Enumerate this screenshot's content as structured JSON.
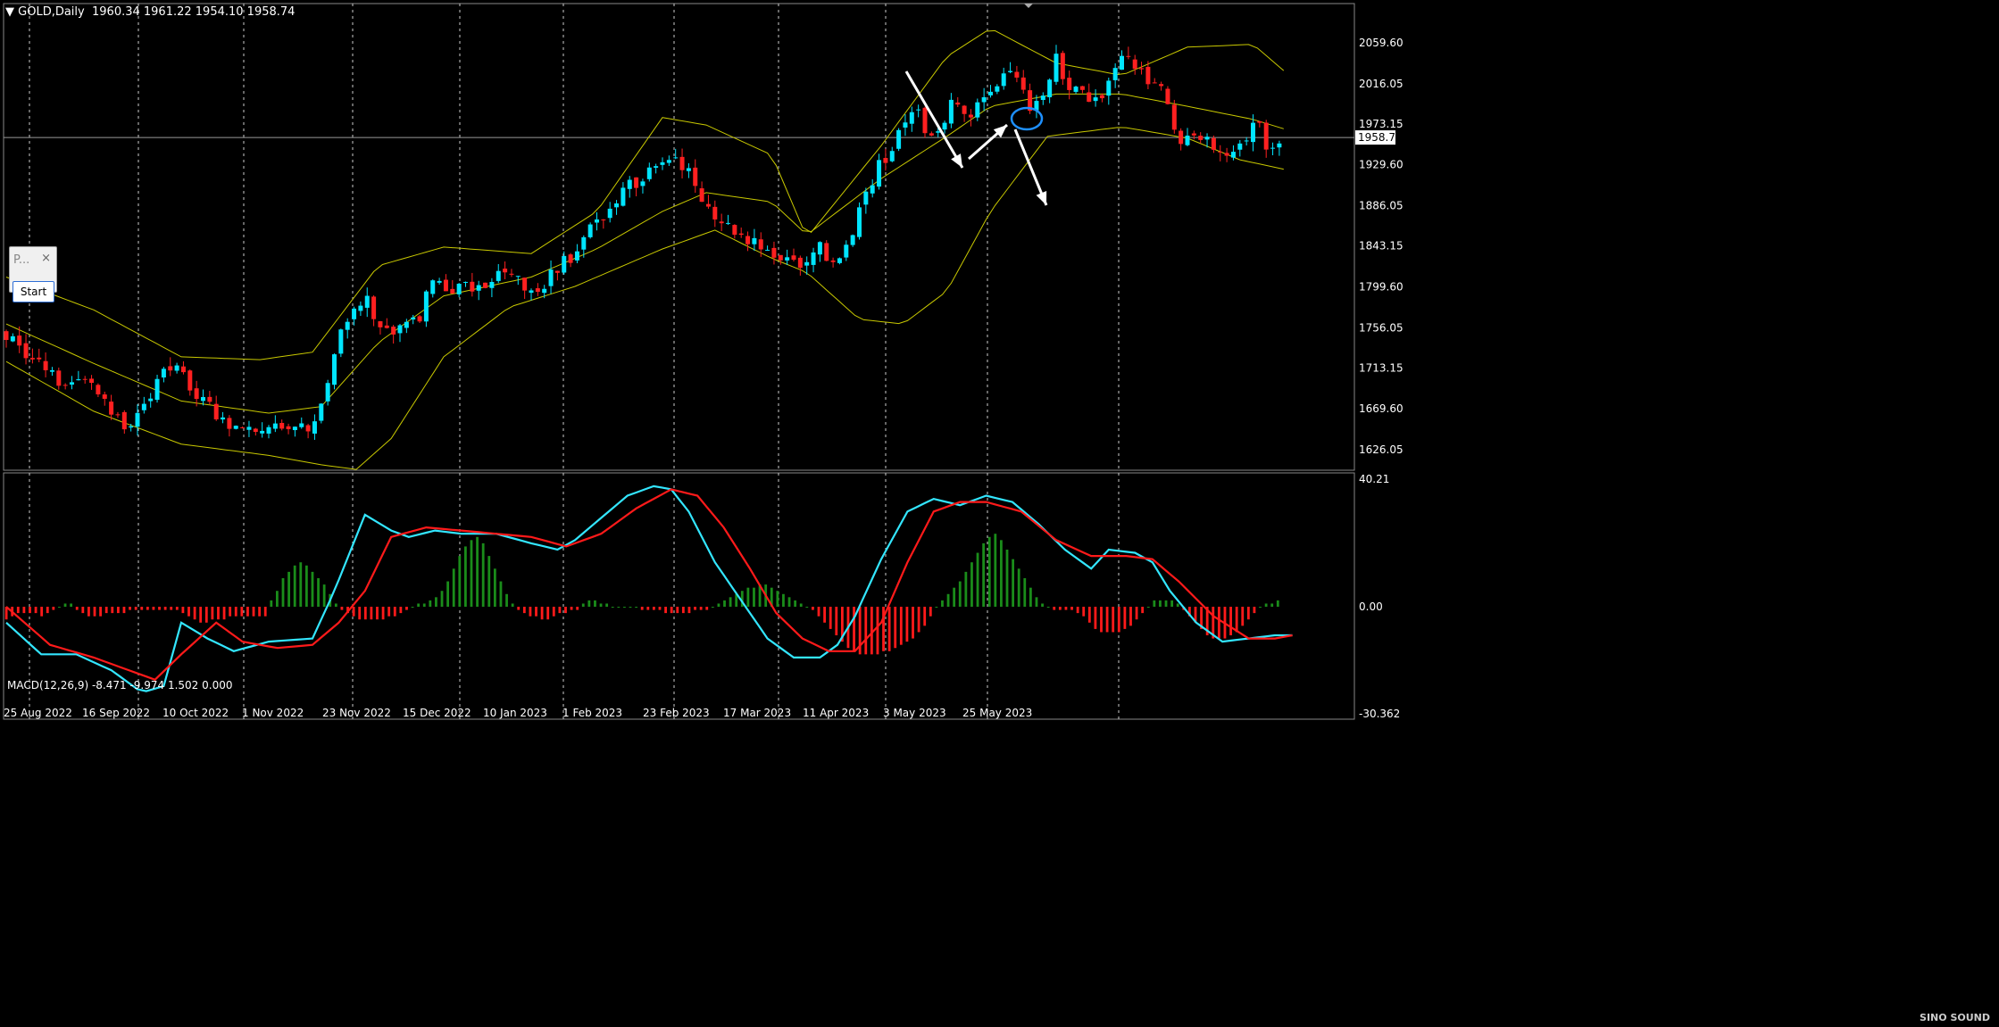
{
  "header": {
    "symbol_label": "GOLD,Daily",
    "ohlc": "1960.34 1961.22 1954.10 1958.74"
  },
  "indicator_title": "MACD(12,26,9) -8.471 -9.974 1.502 0.000",
  "panel": {
    "label": "P...",
    "close": "×",
    "start_label": "Start"
  },
  "logo_text": "SINO SOUND",
  "colors": {
    "background": "#000000",
    "bull_candle": "#00e5ff",
    "bear_candle": "#ff2020",
    "bollinger": "#c8c800",
    "macd_line": "#33e6ff",
    "signal_line": "#ff1a1a",
    "hist_pos": "#1a8c1a",
    "hist_neg": "#ff1a1a",
    "annotation": "#ffffff",
    "circle": "#1e90ff",
    "grid": "#cccccc"
  },
  "chart_data": [
    {
      "type": "candlestick",
      "title": "GOLD,Daily",
      "price_axis_ticks": [
        "2059.60",
        "2016.05",
        "1973.15",
        "1929.60",
        "1886.05",
        "1843.15",
        "1799.60",
        "1756.05",
        "1713.15",
        "1669.60",
        "1626.05"
      ],
      "current_price_label": "1958.74",
      "x_tick_labels": [
        "25 Aug 2022",
        "16 Sep 2022",
        "10 Oct 2022",
        "1 Nov 2022",
        "23 Nov 2022",
        "15 Dec 2022",
        "10 Jan 2023",
        "1 Feb 2023",
        "23 Feb 2023",
        "17 Mar 2023",
        "11 Apr 2023",
        "3 May 2023",
        "25 May 2023"
      ],
      "ylim": [
        1610,
        2090
      ],
      "grid": "vertical dashed",
      "close_path": [
        [
          0,
          1752
        ],
        [
          6,
          1720
        ],
        [
          12,
          1700
        ],
        [
          18,
          1698
        ],
        [
          24,
          1670
        ],
        [
          29,
          1648
        ],
        [
          33,
          1682
        ],
        [
          38,
          1718
        ],
        [
          42,
          1690
        ],
        [
          47,
          1668
        ],
        [
          52,
          1652
        ],
        [
          57,
          1650
        ],
        [
          62,
          1660
        ],
        [
          67,
          1646
        ],
        [
          70,
          1650
        ],
        [
          74,
          1712
        ],
        [
          78,
          1768
        ],
        [
          82,
          1785
        ],
        [
          86,
          1760
        ],
        [
          90,
          1753
        ],
        [
          94,
          1766
        ],
        [
          98,
          1808
        ],
        [
          102,
          1800
        ],
        [
          106,
          1797
        ],
        [
          110,
          1798
        ],
        [
          114,
          1815
        ],
        [
          118,
          1800
        ],
        [
          122,
          1800
        ],
        [
          126,
          1818
        ],
        [
          130,
          1833
        ],
        [
          134,
          1862
        ],
        [
          138,
          1877
        ],
        [
          142,
          1908
        ],
        [
          146,
          1917
        ],
        [
          150,
          1925
        ],
        [
          152,
          1939
        ],
        [
          156,
          1918
        ],
        [
          160,
          1885
        ],
        [
          164,
          1873
        ],
        [
          168,
          1855
        ],
        [
          172,
          1845
        ],
        [
          176,
          1833
        ],
        [
          180,
          1820
        ],
        [
          183,
          1820
        ],
        [
          186,
          1840
        ],
        [
          190,
          1830
        ],
        [
          193,
          1850
        ],
        [
          196,
          1898
        ],
        [
          200,
          1930
        ],
        [
          204,
          1960
        ],
        [
          208,
          1985
        ],
        [
          212,
          1950
        ],
        [
          216,
          1990
        ],
        [
          220,
          1985
        ],
        [
          222,
          2000
        ],
        [
          226,
          2010
        ],
        [
          230,
          2032
        ],
        [
          234,
          1990
        ],
        [
          238,
          2010
        ],
        [
          240,
          2045
        ],
        [
          242,
          2020
        ],
        [
          246,
          2005
        ],
        [
          249,
          2000
        ],
        [
          253,
          2022
        ],
        [
          256,
          2045
        ],
        [
          260,
          2030
        ],
        [
          264,
          2006
        ],
        [
          268,
          1960
        ],
        [
          272,
          1965
        ],
        [
          275,
          1950
        ],
        [
          278,
          1940
        ],
        [
          282,
          1955
        ],
        [
          286,
          1972
        ],
        [
          289,
          1940
        ],
        [
          292,
          1958
        ]
      ],
      "bollinger": {
        "period_shown": "upper/middle/lower bands",
        "upper_path": [
          [
            0,
            1810
          ],
          [
            20,
            1775
          ],
          [
            40,
            1725
          ],
          [
            58,
            1722
          ],
          [
            70,
            1730
          ],
          [
            85,
            1822
          ],
          [
            100,
            1842
          ],
          [
            120,
            1835
          ],
          [
            135,
            1880
          ],
          [
            150,
            1980
          ],
          [
            160,
            1972
          ],
          [
            175,
            1940
          ],
          [
            183,
            1852
          ],
          [
            200,
            1950
          ],
          [
            215,
            2045
          ],
          [
            225,
            2075
          ],
          [
            240,
            2038
          ],
          [
            255,
            2025
          ],
          [
            270,
            2055
          ],
          [
            285,
            2058
          ],
          [
            292,
            2030
          ]
        ],
        "middle_path": [
          [
            0,
            1760
          ],
          [
            20,
            1718
          ],
          [
            40,
            1678
          ],
          [
            60,
            1665
          ],
          [
            72,
            1672
          ],
          [
            85,
            1740
          ],
          [
            100,
            1790
          ],
          [
            120,
            1810
          ],
          [
            135,
            1840
          ],
          [
            150,
            1880
          ],
          [
            160,
            1900
          ],
          [
            175,
            1890
          ],
          [
            183,
            1855
          ],
          [
            200,
            1915
          ],
          [
            215,
            1960
          ],
          [
            225,
            1992
          ],
          [
            240,
            2005
          ],
          [
            255,
            2005
          ],
          [
            270,
            1992
          ],
          [
            285,
            1978
          ],
          [
            292,
            1968
          ]
        ],
        "lower_path": [
          [
            0,
            1720
          ],
          [
            20,
            1667
          ],
          [
            40,
            1632
          ],
          [
            60,
            1620
          ],
          [
            72,
            1610
          ],
          [
            80,
            1605
          ],
          [
            88,
            1638
          ],
          [
            100,
            1725
          ],
          [
            115,
            1778
          ],
          [
            130,
            1800
          ],
          [
            140,
            1820
          ],
          [
            150,
            1840
          ],
          [
            162,
            1860
          ],
          [
            175,
            1830
          ],
          [
            183,
            1815
          ],
          [
            195,
            1765
          ],
          [
            205,
            1760
          ],
          [
            215,
            1795
          ],
          [
            225,
            1880
          ],
          [
            238,
            1960
          ],
          [
            255,
            1970
          ],
          [
            270,
            1958
          ],
          [
            282,
            1935
          ],
          [
            292,
            1925
          ]
        ]
      }
    },
    {
      "type": "macd",
      "title": "MACD(12,26,9) -8.471 -9.974 1.502 0.000",
      "axis_ticks": [
        "40.21",
        "0.00",
        "-30.362"
      ],
      "ylim": [
        -31,
        40.21
      ],
      "macd_path": [
        [
          0,
          -5
        ],
        [
          8,
          -15
        ],
        [
          16,
          -15
        ],
        [
          24,
          -20
        ],
        [
          31,
          -27
        ],
        [
          36,
          -25
        ],
        [
          40,
          -5
        ],
        [
          46,
          -10
        ],
        [
          52,
          -14
        ],
        [
          60,
          -11
        ],
        [
          70,
          -10
        ],
        [
          75,
          5
        ],
        [
          82,
          29
        ],
        [
          88,
          24
        ],
        [
          92,
          22
        ],
        [
          98,
          24
        ],
        [
          104,
          23
        ],
        [
          112,
          23
        ],
        [
          120,
          20
        ],
        [
          126,
          18
        ],
        [
          130,
          21
        ],
        [
          136,
          28
        ],
        [
          142,
          35
        ],
        [
          148,
          38
        ],
        [
          152,
          37
        ],
        [
          156,
          30
        ],
        [
          162,
          14
        ],
        [
          168,
          2
        ],
        [
          174,
          -10
        ],
        [
          180,
          -16
        ],
        [
          186,
          -16
        ],
        [
          190,
          -12
        ],
        [
          194,
          -3
        ],
        [
          200,
          15
        ],
        [
          206,
          30
        ],
        [
          212,
          34
        ],
        [
          218,
          32
        ],
        [
          224,
          35
        ],
        [
          230,
          33
        ],
        [
          236,
          26
        ],
        [
          242,
          18
        ],
        [
          248,
          12
        ],
        [
          252,
          18
        ],
        [
          258,
          17
        ],
        [
          262,
          14
        ],
        [
          266,
          5
        ],
        [
          272,
          -5
        ],
        [
          278,
          -11
        ],
        [
          284,
          -10
        ],
        [
          290,
          -9
        ],
        [
          294,
          -9
        ]
      ],
      "signal_path": [
        [
          0,
          0
        ],
        [
          10,
          -12
        ],
        [
          20,
          -16
        ],
        [
          28,
          -20
        ],
        [
          34,
          -23
        ],
        [
          40,
          -15
        ],
        [
          48,
          -5
        ],
        [
          54,
          -11
        ],
        [
          62,
          -13
        ],
        [
          70,
          -12
        ],
        [
          76,
          -5
        ],
        [
          82,
          5
        ],
        [
          88,
          22
        ],
        [
          96,
          25
        ],
        [
          104,
          24
        ],
        [
          112,
          23
        ],
        [
          120,
          22
        ],
        [
          128,
          19
        ],
        [
          136,
          23
        ],
        [
          144,
          31
        ],
        [
          152,
          37
        ],
        [
          158,
          35
        ],
        [
          164,
          25
        ],
        [
          170,
          12
        ],
        [
          176,
          -2
        ],
        [
          182,
          -10
        ],
        [
          188,
          -14
        ],
        [
          194,
          -14
        ],
        [
          200,
          -5
        ],
        [
          206,
          14
        ],
        [
          212,
          30
        ],
        [
          218,
          33
        ],
        [
          224,
          33
        ],
        [
          232,
          30
        ],
        [
          240,
          21
        ],
        [
          248,
          16
        ],
        [
          256,
          16
        ],
        [
          262,
          15
        ],
        [
          268,
          8
        ],
        [
          276,
          -3
        ],
        [
          284,
          -10
        ],
        [
          290,
          -10
        ],
        [
          294,
          -9
        ]
      ],
      "histogram": [
        -4,
        -3,
        -2,
        -2,
        -2,
        -2,
        -3,
        -2,
        -1,
        0,
        1,
        1,
        -1,
        -2,
        -3,
        -3,
        -3,
        -2,
        -2,
        -2,
        -2,
        -1,
        -1,
        -1,
        -1,
        -1,
        -1,
        -1,
        -1,
        -1,
        -2,
        -3,
        -4,
        -5,
        -5,
        -4,
        -4,
        -4,
        -3,
        -3,
        -3,
        -3,
        -3,
        -3,
        -3,
        2,
        5,
        9,
        11,
        13,
        14,
        13,
        11,
        9,
        7,
        4,
        1,
        -1,
        -2,
        -3,
        -4,
        -4,
        -4,
        -4,
        -4,
        -3,
        -3,
        -2,
        -1,
        0,
        1,
        1,
        2,
        3,
        5,
        8,
        12,
        16,
        19,
        21,
        22,
        20,
        16,
        12,
        8,
        4,
        1,
        -1,
        -2,
        -3,
        -3,
        -4,
        -4,
        -3,
        -2,
        -2,
        -1,
        -1,
        1,
        2,
        2,
        1,
        1,
        0,
        0,
        0,
        0,
        0,
        -1,
        -1,
        -1,
        -1,
        -2,
        -2,
        -2,
        -2,
        -2,
        -1,
        -1,
        -1,
        0,
        1,
        2,
        3,
        4,
        5,
        6,
        6,
        7,
        7,
        6,
        5,
        4,
        3,
        2,
        1,
        0,
        -1,
        -3,
        -5,
        -7,
        -9,
        -11,
        -13,
        -14,
        -15,
        -15,
        -15,
        -15,
        -14,
        -14,
        -13,
        -12,
        -11,
        -10,
        -8,
        -6,
        -3,
        0,
        2,
        4,
        6,
        8,
        11,
        14,
        17,
        20,
        22,
        23,
        21,
        18,
        15,
        12,
        9,
        6,
        3,
        1,
        0,
        -1,
        -1,
        -1,
        -1,
        -2,
        -3,
        -5,
        -7,
        -8,
        -8,
        -8,
        -8,
        -7,
        -6,
        -4,
        -2,
        0,
        2,
        2,
        2,
        2,
        1,
        -1,
        -3,
        -5,
        -7,
        -9,
        -10,
        -10,
        -10,
        -9,
        -8,
        -6,
        -4,
        -2,
        0,
        1,
        1,
        2
      ]
    }
  ],
  "annotations": [
    "white arrow down",
    "white arrow up",
    "white arrow down",
    "blue circle"
  ]
}
